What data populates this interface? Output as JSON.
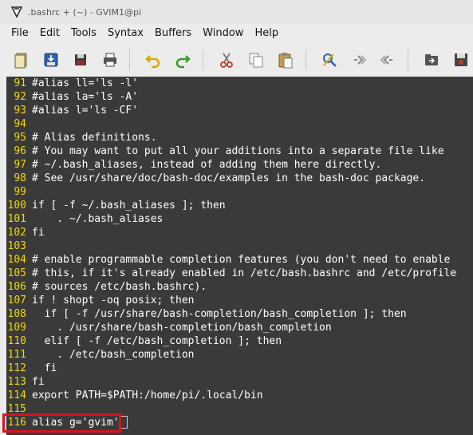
{
  "window": {
    "title": ".bashrc + (~) - GVIM1@pi"
  },
  "menu": [
    "File",
    "Edit",
    "Tools",
    "Syntax",
    "Buffers",
    "Window",
    "Help"
  ],
  "toolbar": {
    "group1": [
      "open-icon",
      "save-download-icon",
      "save-all-icon",
      "print-icon"
    ],
    "group2": [
      "undo-icon",
      "redo-icon"
    ],
    "group3": [
      "cut-icon",
      "copy-icon",
      "paste-icon"
    ],
    "group4": [
      "find-replace-icon",
      "find-next-icon",
      "find-previous-icon"
    ],
    "group5": [
      "load-session-icon",
      "save-session-icon"
    ]
  },
  "colors": {
    "line_number": "#f5d800",
    "editor_bg": "#3a3a3a",
    "highlight": "#d9141b"
  },
  "editor": {
    "lines": [
      {
        "n": "91",
        "t": "#alias ll='ls -l'"
      },
      {
        "n": "92",
        "t": "#alias la='ls -A'"
      },
      {
        "n": "93",
        "t": "#alias l='ls -CF'"
      },
      {
        "n": "94",
        "t": ""
      },
      {
        "n": "95",
        "t": "# Alias definitions."
      },
      {
        "n": "96",
        "t": "# You may want to put all your additions into a separate file like"
      },
      {
        "n": "97",
        "t": "# ~/.bash_aliases, instead of adding them here directly."
      },
      {
        "n": "98",
        "t": "# See /usr/share/doc/bash-doc/examples in the bash-doc package."
      },
      {
        "n": "99",
        "t": ""
      },
      {
        "n": "100",
        "t": "if [ -f ~/.bash_aliases ]; then"
      },
      {
        "n": "101",
        "t": "    . ~/.bash_aliases"
      },
      {
        "n": "102",
        "t": "fi"
      },
      {
        "n": "103",
        "t": ""
      },
      {
        "n": "104",
        "t": "# enable programmable completion features (you don't need to enable"
      },
      {
        "n": "105",
        "t": "# this, if it's already enabled in /etc/bash.bashrc and /etc/profile"
      },
      {
        "n": "106",
        "t": "# sources /etc/bash.bashrc)."
      },
      {
        "n": "107",
        "t": "if ! shopt -oq posix; then"
      },
      {
        "n": "108",
        "t": "  if [ -f /usr/share/bash-completion/bash_completion ]; then"
      },
      {
        "n": "109",
        "t": "    . /usr/share/bash-completion/bash_completion"
      },
      {
        "n": "110",
        "t": "  elif [ -f /etc/bash_completion ]; then"
      },
      {
        "n": "111",
        "t": "    . /etc/bash_completion"
      },
      {
        "n": "112",
        "t": "  fi"
      },
      {
        "n": "113",
        "t": "fi"
      },
      {
        "n": "114",
        "t": "export PATH=$PATH:/home/pi/.local/bin"
      },
      {
        "n": "115",
        "t": ""
      },
      {
        "n": "116",
        "t": "alias g='gvim'"
      }
    ]
  }
}
